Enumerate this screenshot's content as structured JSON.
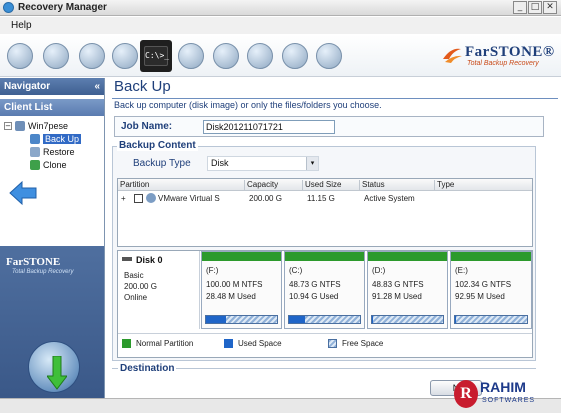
{
  "window": {
    "title": "Recovery Manager",
    "buttons": [
      "_",
      "□",
      "✕"
    ]
  },
  "menu": {
    "help": "Help"
  },
  "toolbar": {
    "active_icon_text": "C:\\>_",
    "icons": [
      "add-icon",
      "backup-globe-icon",
      "network-icon",
      "search-icon",
      "console-icon",
      "eraser-icon",
      "document-icon",
      "disk-icon",
      "settings-gears-icon",
      "tools-icon"
    ]
  },
  "logo": {
    "name": "FarSTONE®",
    "tagline": "Total Backup Recovery"
  },
  "navigator": {
    "title": "Navigator",
    "collapse": "«",
    "client_list": "Client List",
    "tree": {
      "root": "Win7pese",
      "expander": "−",
      "items": [
        "Back Up",
        "Restore",
        "Clone"
      ],
      "selected": "Back Up"
    },
    "brand": {
      "name": "FarSTONE",
      "tagline": "Total Backup Recovery"
    }
  },
  "page": {
    "title": "Back Up",
    "description": "Back up computer (disk image) or only the files/folders you choose."
  },
  "job": {
    "label": "Job Name:",
    "value": "Disk201211071721"
  },
  "backup_content": {
    "title": "Backup Content",
    "type_label": "Backup Type",
    "type_value": "Disk",
    "type_arrow": "▾",
    "columns": [
      "Partition",
      "Capacity",
      "Used Size",
      "Status",
      "Type"
    ],
    "rows": [
      {
        "expander": "+",
        "partition": "VMware Virtual S",
        "capacity": "200.00 G",
        "used": "11.15 G",
        "status": "Active System",
        "type": ""
      }
    ]
  },
  "disk": {
    "name": "Disk 0",
    "kind": "Basic",
    "size": "200.00 G",
    "status": "Online",
    "partitions": [
      {
        "letter": "(F:)",
        "size": "100.00 M NTFS",
        "used": "28.48 M Used",
        "used_fraction": 0.28
      },
      {
        "letter": "(C:)",
        "size": "48.73 G NTFS",
        "used": "10.94 G Used",
        "used_fraction": 0.22
      },
      {
        "letter": "(D:)",
        "size": "48.83 G NTFS",
        "used": "91.28 M Used",
        "used_fraction": 0.01
      },
      {
        "letter": "(E:)",
        "size": "102.34 G NTFS",
        "used": "92.95 M Used",
        "used_fraction": 0.01
      }
    ]
  },
  "legend": {
    "normal": "Normal Partition",
    "used": "Used Space",
    "free": "Free Space",
    "colors": {
      "normal": "#2c9a2c",
      "used": "#1f65c8",
      "free": "#8fb0d8"
    }
  },
  "destination": {
    "title": "Destination"
  },
  "next_button": "N",
  "watermark": {
    "letter": "R",
    "line1": "RAHIM",
    "line2": "SOFTWARES"
  }
}
